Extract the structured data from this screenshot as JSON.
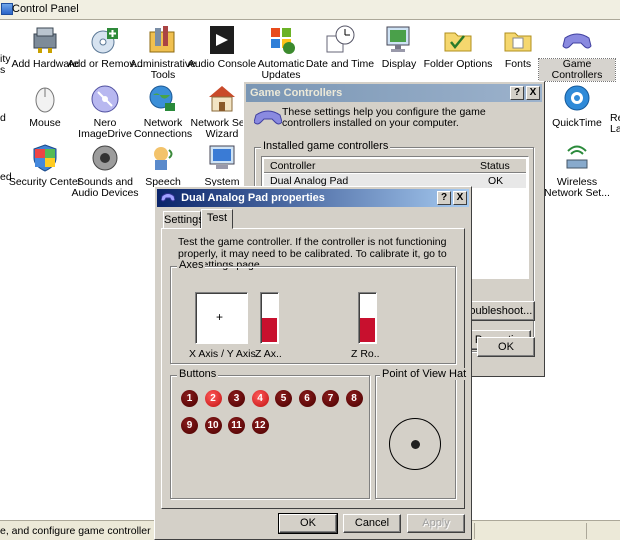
{
  "control_panel": {
    "title": "Control Panel",
    "edge_row1": "ity\ns",
    "edge_row2": "d",
    "edge_row3": "ed",
    "right_edge_row2": "Re\nLa",
    "items": [
      {
        "label": "Add Hardware",
        "icon": "add-hardware-icon"
      },
      {
        "label": "Add or Remov...",
        "icon": "add-remove-programs-icon"
      },
      {
        "label": "Administrative Tools",
        "icon": "administrative-tools-icon"
      },
      {
        "label": "Audio Console",
        "icon": "audio-console-icon"
      },
      {
        "label": "Automatic Updates",
        "icon": "automatic-updates-icon"
      },
      {
        "label": "Date and Time",
        "icon": "date-time-icon"
      },
      {
        "label": "Display",
        "icon": "display-icon"
      },
      {
        "label": "Folder Options",
        "icon": "folder-options-icon"
      },
      {
        "label": "Fonts",
        "icon": "fonts-icon"
      },
      {
        "label": "Game Controllers",
        "icon": "game-controllers-icon"
      },
      {
        "label": "Mouse",
        "icon": "mouse-icon"
      },
      {
        "label": "Nero ImageDrive",
        "icon": "nero-imagedrive-icon"
      },
      {
        "label": "Network Connections",
        "icon": "network-connections-icon"
      },
      {
        "label": "Network Setu Wizard",
        "icon": "network-setup-wizard-icon"
      },
      {
        "label": "QuickTime",
        "icon": "quicktime-icon"
      },
      {
        "label": "Security Center",
        "icon": "security-center-icon"
      },
      {
        "label": "Sounds and Audio Devices",
        "icon": "sounds-audio-icon"
      },
      {
        "label": "Speech",
        "icon": "speech-icon"
      },
      {
        "label": "System",
        "icon": "system-icon"
      },
      {
        "label": "Wireless Network Set...",
        "icon": "wireless-network-setup-icon"
      }
    ],
    "status_text": "e, and configure game controller hardwa"
  },
  "game_controllers": {
    "title": "Game Controllers",
    "help_button": "?",
    "close_button": "X",
    "intro": "These settings help you configure the game controllers installed on your computer.",
    "group_label": "Installed game controllers",
    "columns": [
      "Controller",
      "Status"
    ],
    "rows": [
      {
        "controller": "Dual Analog Pad",
        "status": "OK"
      }
    ],
    "properties_button": "Properties",
    "troubleshoot_button": "roubleshoot...",
    "ok_button": "OK"
  },
  "properties": {
    "title": "Dual Analog Pad properties",
    "help_button": "?",
    "close_button": "X",
    "tabs": [
      "Settings",
      "Test"
    ],
    "active_tab": "Test",
    "instructions": "Test the game controller.  If the controller is not functioning properly, it may need to be calibrated.  To calibrate it, go to the Settings page.",
    "axes_label": "Axes",
    "xy_label": "X Axis / Y Axis",
    "crosshair": "+",
    "z_axis_label": "Z Ax..",
    "z_rot_label": "Z Ro..",
    "z_axis_level": 0.5,
    "z_rot_level": 0.5,
    "bar_color": "#c8102e",
    "buttons_label": "Buttons",
    "buttons": [
      {
        "n": "1",
        "pressed": false
      },
      {
        "n": "2",
        "pressed": true
      },
      {
        "n": "3",
        "pressed": false
      },
      {
        "n": "4",
        "pressed": true
      },
      {
        "n": "5",
        "pressed": false
      },
      {
        "n": "6",
        "pressed": false
      },
      {
        "n": "7",
        "pressed": false
      },
      {
        "n": "8",
        "pressed": false
      },
      {
        "n": "9",
        "pressed": false
      },
      {
        "n": "10",
        "pressed": false
      },
      {
        "n": "11",
        "pressed": false
      },
      {
        "n": "12",
        "pressed": false
      }
    ],
    "pov_label": "Point of View Hat",
    "ok_button": "OK",
    "cancel_button": "Cancel",
    "apply_button": "Apply"
  }
}
